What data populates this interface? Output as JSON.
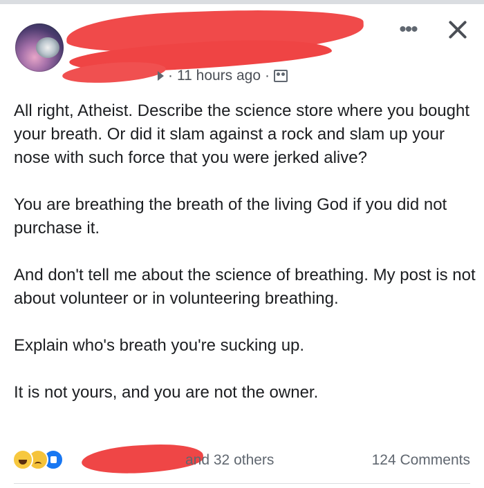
{
  "post": {
    "timestamp": "11 hours ago",
    "separator": "·",
    "privacy_icon": "friends-icon",
    "more_label": "•••",
    "close_icon": "close-icon",
    "paragraphs": [
      "All right, Atheist. Describe the science store where you bought your breath. Or did it slam against a rock and slam up your nose with such force that you were jerked alive?",
      "You are breathing the breath of the living God if you did not purchase it.",
      "And don't tell me about the science of breathing. My post is not about volunteer or in volunteering breathing.",
      "Explain who's breath you're sucking up.",
      "It is not yours, and you are not the owner."
    ]
  },
  "footer": {
    "reactions": [
      "haha-icon",
      "sad-icon",
      "like-icon"
    ],
    "others_label": "and 32 others",
    "comments_label": "124 Comments"
  },
  "colors": {
    "redaction": "#ef4444",
    "text": "#1c1e21",
    "meta": "#606770",
    "like_blue": "#1877f2"
  }
}
